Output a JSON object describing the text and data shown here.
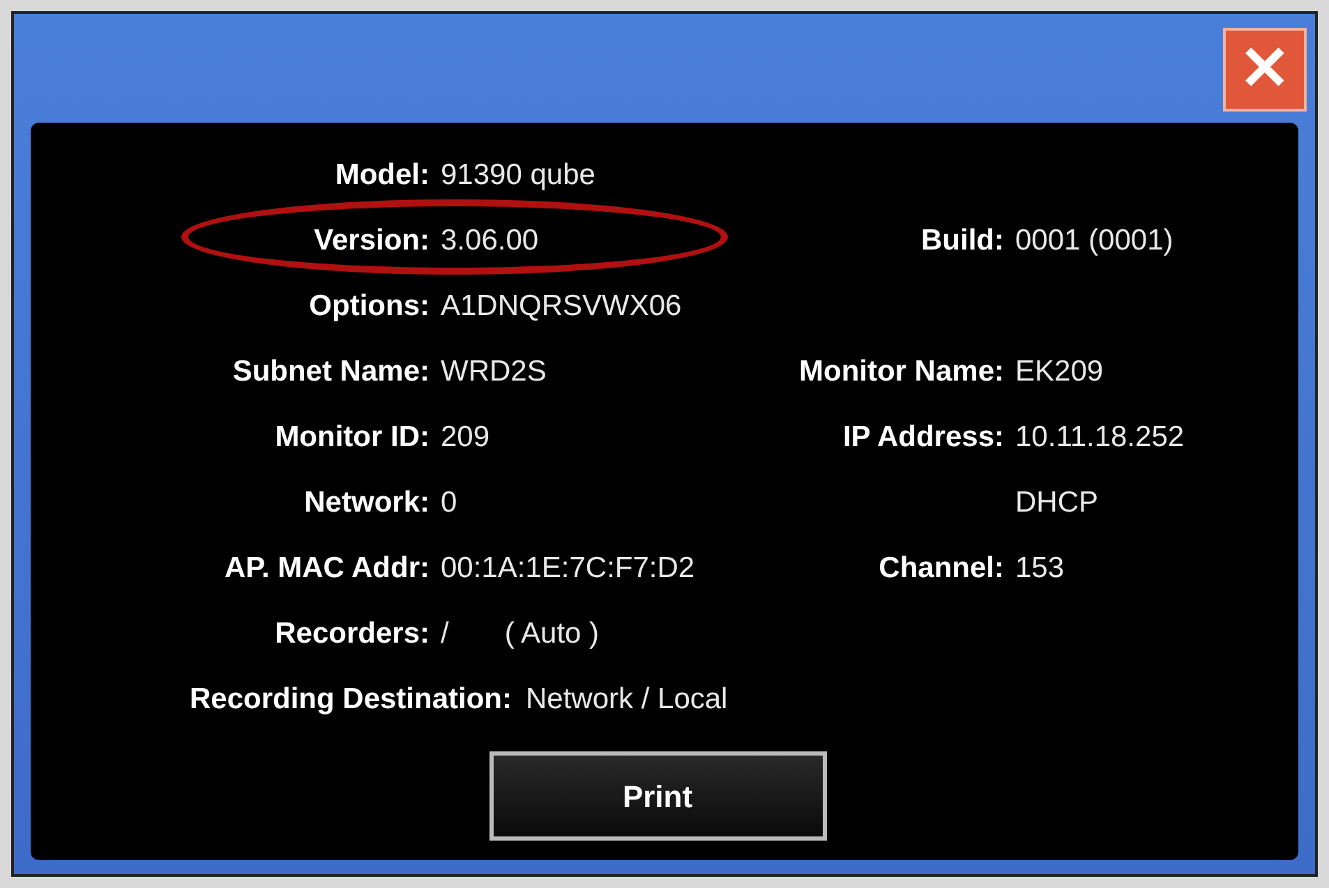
{
  "dialog": {
    "close_label": "✕"
  },
  "rows": [
    {
      "kind": "pair",
      "highlighted": false,
      "label": "Model:",
      "value": "91390 qube"
    },
    {
      "kind": "pair",
      "highlighted": true,
      "label": "Version:",
      "value": "3.06.00",
      "right_label": "Build:",
      "right_value": "0001 (0001)"
    },
    {
      "kind": "pair",
      "highlighted": false,
      "label": "Options:",
      "value": "A1DNQRSVWX06"
    },
    {
      "kind": "pair",
      "highlighted": false,
      "label": "Subnet Name:",
      "value": "WRD2S",
      "right_label": "Monitor Name:",
      "right_value": "EK209"
    },
    {
      "kind": "pair",
      "highlighted": false,
      "label": "Monitor ID:",
      "value": "209",
      "right_label": "IP Address:",
      "right_value": "10.11.18.252"
    },
    {
      "kind": "pair",
      "highlighted": false,
      "label": "Network:",
      "value": "0",
      "right_value": "DHCP"
    },
    {
      "kind": "pair",
      "highlighted": false,
      "label": "AP. MAC Addr:",
      "value": "00:1A:1E:7C:F7:D2",
      "right_label": "Channel:",
      "right_value": "153"
    },
    {
      "kind": "pair",
      "highlighted": false,
      "label": "Recorders:",
      "value": "/",
      "extra": "( Auto )"
    },
    {
      "kind": "wide",
      "highlighted": false,
      "label": "Recording Destination:",
      "value": "Network / Local"
    }
  ],
  "print_button": "Print"
}
